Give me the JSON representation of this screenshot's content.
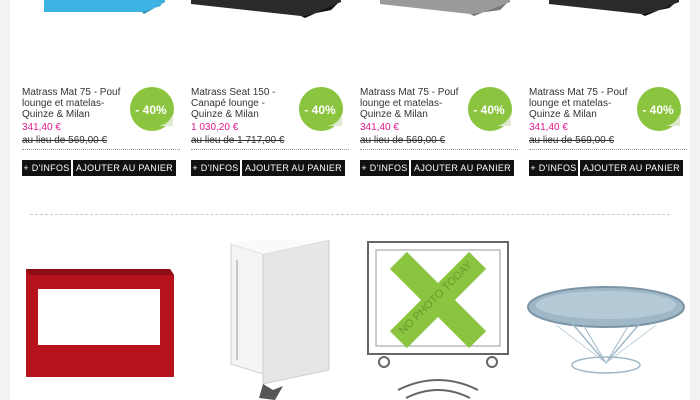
{
  "products": [
    {
      "name": "Matrass Mat 75 - Pouf lounge et matelas- Quinze & Milan",
      "price": "341,40 €",
      "old_price": "au lieu de 569,00 €",
      "discount": "- 40%",
      "image_color": "#3cb3e3",
      "info_label": "+ D'INFOS",
      "cart_label": "AJOUTER AU PANIER"
    },
    {
      "name": "Matrass Seat 150 - Canapé lounge - Quinze & Milan",
      "price": "1 030,20 €",
      "old_price": "au lieu de 1 717,00 €",
      "discount": "- 40%",
      "image_color": "#2a2a2a",
      "info_label": "+ D'INFOS",
      "cart_label": "AJOUTER AU PANIER"
    },
    {
      "name": "Matrass Mat 75 - Pouf lounge et matelas- Quinze & Milan",
      "price": "341,40 €",
      "old_price": "au lieu de 569,00 €",
      "discount": "- 40%",
      "image_color": "#9a9a9a",
      "info_label": "+ D'INFOS",
      "cart_label": "AJOUTER AU PANIER"
    },
    {
      "name": "Matrass Mat 75 - Pouf lounge et matelas- Quinze & Milan",
      "price": "341,40 €",
      "old_price": "au lieu de 569,00 €",
      "discount": "- 40%",
      "image_color": "#2a2a2a",
      "info_label": "+ D'INFOS",
      "cart_label": "AJOUTER AU PANIER"
    }
  ],
  "thumbnails": [
    {
      "icon": "red-shelf-image",
      "color": "#b5121b"
    },
    {
      "icon": "white-cabinet-image",
      "color": "#e8e8e8"
    },
    {
      "icon": "no-photo-today-placeholder",
      "label": "NO PHOTO TODAY",
      "color": "#8bc43f"
    },
    {
      "icon": "glass-table-image",
      "color": "#9fb8c8"
    }
  ],
  "colors": {
    "price": "#e0198b",
    "badge_green": "#8bc43f",
    "button_bg": "#111111"
  }
}
